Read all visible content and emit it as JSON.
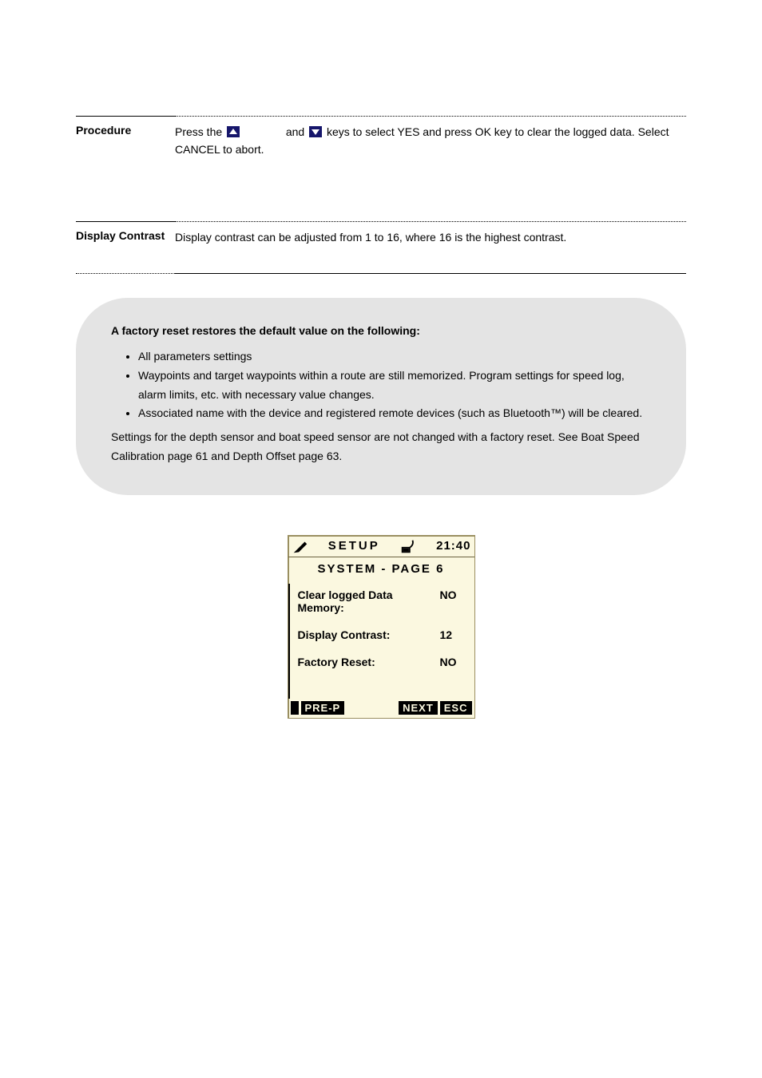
{
  "rows": {
    "procedure": {
      "label": "Procedure",
      "desc_before": "Press the — and — keys to select YES and press OK key to clear the logged data. Select CANCEL to abort.",
      "desc_up_segment": "Press the ",
      "desc_mid_segment": " and ",
      "desc_after_segment": " keys to select YES and press OK key to clear the logged data. Select CANCEL to abort."
    },
    "display_contrast": {
      "label": "Display Contrast",
      "desc": "Display contrast can be adjusted from 1 to 16, where 16 is the highest contrast."
    }
  },
  "note": {
    "line1": "A factory reset restores the default value on the following:",
    "bullets": [
      "All parameters settings",
      "Waypoints and target waypoints within a route are still memorized. Program settings for speed log, alarm limits, etc. with necessary value changes.",
      "Associated name with the device and registered remote devices (such as Bluetooth™) will be cleared."
    ],
    "line2": "Settings for the depth sensor and boat speed sensor are not changed with a factory reset. See Boat Speed Calibration page 61 and Depth Offset page 63."
  },
  "lcd": {
    "title": "SETUP",
    "time": "21:40",
    "subtitle": "SYSTEM - PAGE 6",
    "lines": [
      {
        "label": "Clear logged Data Memory:",
        "value": "NO"
      },
      {
        "label": "Display Contrast:",
        "value": "12"
      },
      {
        "label": "Factory Reset:",
        "value": "NO"
      }
    ],
    "buttons": {
      "prev": "PRE-P",
      "next": "NEXT",
      "esc": "ESC"
    }
  }
}
